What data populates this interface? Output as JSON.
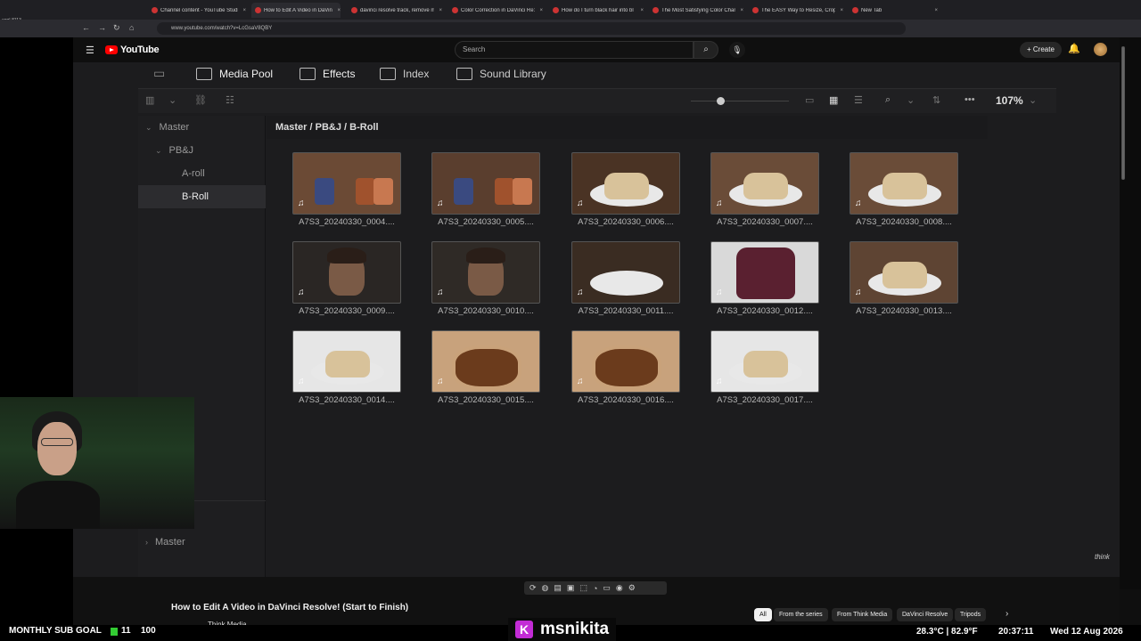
{
  "browser": {
    "corner_label": "eggl-8113...",
    "tabs": [
      {
        "label": "Channel content - YouTube Studio",
        "active": false
      },
      {
        "label": "How to Edit A Video in DaVinci",
        "active": true
      },
      {
        "label": "davinci resolve track, remove m",
        "active": false
      },
      {
        "label": "Color Correction in DaVinci Re:",
        "active": false
      },
      {
        "label": "How do I turn black hair into bl",
        "active": false
      },
      {
        "label": "The Most Satisfying Color Chan",
        "active": false
      },
      {
        "label": "The EASY Way to Resize, Crop &",
        "active": false
      },
      {
        "label": "New Tab",
        "active": false
      }
    ],
    "url": "www.youtube.com/watch?v=LcGsaV8QBY"
  },
  "youtube": {
    "logo": "YouTube",
    "search_placeholder": "Search",
    "create_label": "Create",
    "video_title": "How to Edit A Video in DaVinci Resolve! (Start to Finish)",
    "channel": "Think Media",
    "watermark": "think",
    "chips": [
      {
        "label": "All",
        "active": true
      },
      {
        "label": "From the series",
        "active": false
      },
      {
        "label": "From Think Media",
        "active": false
      },
      {
        "label": "DaVinci Resolve",
        "active": false
      },
      {
        "label": "Tripods",
        "active": false
      }
    ]
  },
  "resolve": {
    "tabs": [
      {
        "label": "Media Pool",
        "icon": "media-pool-icon"
      },
      {
        "label": "Effects",
        "icon": "effects-icon"
      },
      {
        "label": "Index",
        "icon": "index-icon"
      },
      {
        "label": "Sound Library",
        "icon": "sound-library-icon"
      }
    ],
    "zoom_percent": "107%",
    "zoom_slider_level": 0.3,
    "breadcrumb": "Master / PB&J / B-Roll",
    "bins": [
      {
        "label": "Master",
        "chevron": "▼",
        "selected": false
      },
      {
        "label": "PB&J",
        "chevron": "▼",
        "selected": false
      },
      {
        "label": "A-roll",
        "chevron": "",
        "selected": false
      },
      {
        "label": "B-Roll",
        "chevron": "",
        "selected": true
      }
    ],
    "bottom_bin": "Master",
    "clips": [
      {
        "name": "A7S3_20240330_0004....",
        "kind": "jars-table",
        "color": "#6b4a35"
      },
      {
        "name": "A7S3_20240330_0005....",
        "kind": "jars-table",
        "color": "#5a3e2e"
      },
      {
        "name": "A7S3_20240330_0006....",
        "kind": "plate-sandwich",
        "color": "#4a3324"
      },
      {
        "name": "A7S3_20240330_0007....",
        "kind": "plate-sandwich",
        "color": "#6a4c38"
      },
      {
        "name": "A7S3_20240330_0008....",
        "kind": "plate-sandwich",
        "color": "#6a4c38"
      },
      {
        "name": "A7S3_20240330_0009....",
        "kind": "man",
        "color": "#2a2624"
      },
      {
        "name": "A7S3_20240330_0010....",
        "kind": "man",
        "color": "#2f2a26"
      },
      {
        "name": "A7S3_20240330_0011....",
        "kind": "plate",
        "color": "#3a2c22"
      },
      {
        "name": "A7S3_20240330_0012....",
        "kind": "jam-bread",
        "color": "#d9d9d9"
      },
      {
        "name": "A7S3_20240330_0013....",
        "kind": "plate-bread",
        "color": "#5e4433"
      },
      {
        "name": "A7S3_20240330_0014....",
        "kind": "plate-bread",
        "color": "#e6e6e6"
      },
      {
        "name": "A7S3_20240330_0015....",
        "kind": "jar-top",
        "color": "#c8a27c"
      },
      {
        "name": "A7S3_20240330_0016....",
        "kind": "jar-top",
        "color": "#c8a27c"
      },
      {
        "name": "A7S3_20240330_0017....",
        "kind": "plate-bread",
        "color": "#e6e6e6"
      }
    ]
  },
  "overlay": {
    "sub_goal_label": "MONTHLY SUB GOAL",
    "sub_goal_current": "11",
    "sub_goal_max": "100",
    "streamer": "msnikita",
    "streamer_badge": "K",
    "temperature": "28.3°C | 82.9°F",
    "time": "20:37:11",
    "date": "Wed 12 Aug 2026"
  }
}
